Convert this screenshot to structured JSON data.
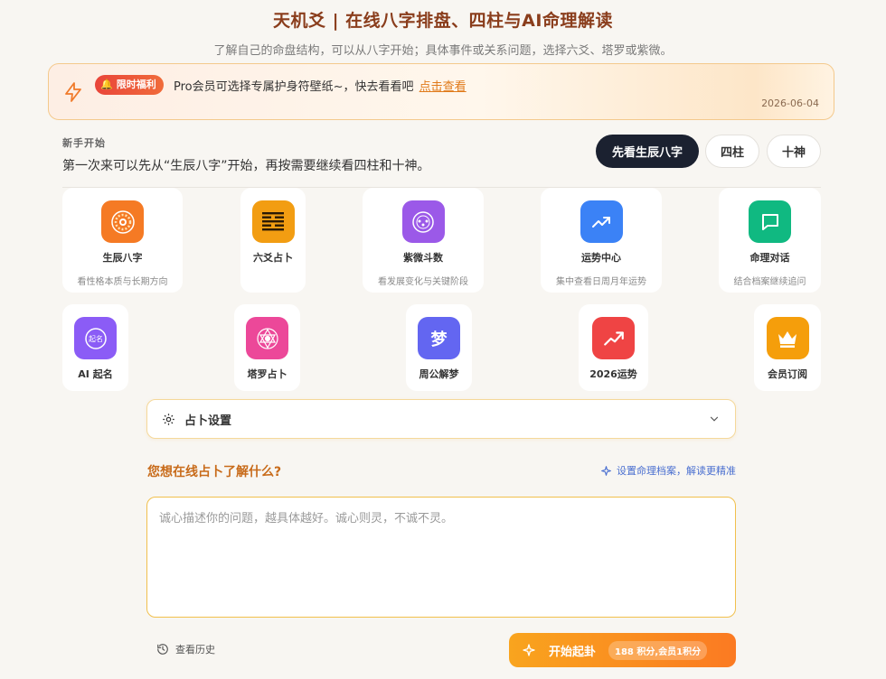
{
  "header": {
    "title": "天机爻 | 在线八字排盘、四柱与AI命理解读",
    "subtitle": "了解自己的命盘结构，可以从八字开始；具体事件或关系问题，选择六爻、塔罗或紫微。"
  },
  "banner": {
    "icon": "lightning-icon",
    "badge_icon": "bell-icon",
    "badge": "限时福利",
    "text": "Pro会员可选择专属护身符壁纸~，快去看看吧",
    "link": "点击查看",
    "date": "2026-06-04",
    "accent": "#e07a1a"
  },
  "starter": {
    "label": "新手开始",
    "text": "第一次来可以先从“生辰八字”开始，再按需要继续看四柱和十神。",
    "buttons": [
      "先看生辰八字",
      "四柱",
      "十神"
    ]
  },
  "tools_primary": [
    {
      "label": "生辰八字",
      "desc": "看性格本质与长期方向",
      "icon": "bagua-wheel-icon",
      "color": "#f57a24"
    },
    {
      "label": "六爻占卜",
      "desc": "",
      "icon": "hexagram-icon",
      "color": "#f29d12"
    },
    {
      "label": "紫微斗数",
      "desc": "看发展变化与关键阶段",
      "icon": "ziwei-chart-icon",
      "color": "#9b59e8"
    },
    {
      "label": "运势中心",
      "desc": "集中查看日周月年运势",
      "icon": "trend-up-icon",
      "color": "#3b82f6"
    },
    {
      "label": "命理对话",
      "desc": "结合档案继续追问",
      "icon": "chat-bubble-icon",
      "color": "#10b981"
    }
  ],
  "tools_secondary": [
    {
      "label": "AI 起名",
      "icon": "naming-face-icon",
      "color": "#8b5cf6"
    },
    {
      "label": "塔罗占卜",
      "icon": "tarot-eye-icon",
      "color": "#ec4899"
    },
    {
      "label": "周公解梦",
      "icon": "dream-icon",
      "glyph": "梦",
      "color": "#6366f1"
    },
    {
      "label": "2026运势",
      "icon": "fortune-2026-icon",
      "color": "#ef4444"
    },
    {
      "label": "会员订阅",
      "icon": "crown-icon",
      "color": "#f59e0b"
    }
  ],
  "settings": {
    "label": "占卜设置",
    "icon": "gear-icon",
    "chevron": "chevron-down-icon"
  },
  "question": {
    "title": "您想在线占卜了解什么?",
    "profile_link": "设置命理档案，解读更精准",
    "placeholder": "诚心描述你的问题，越具体越好。诚心则灵，不诚不灵。"
  },
  "footer": {
    "history": "查看历史",
    "start": "开始起卦",
    "cost": "188 积分,会员1积分"
  }
}
